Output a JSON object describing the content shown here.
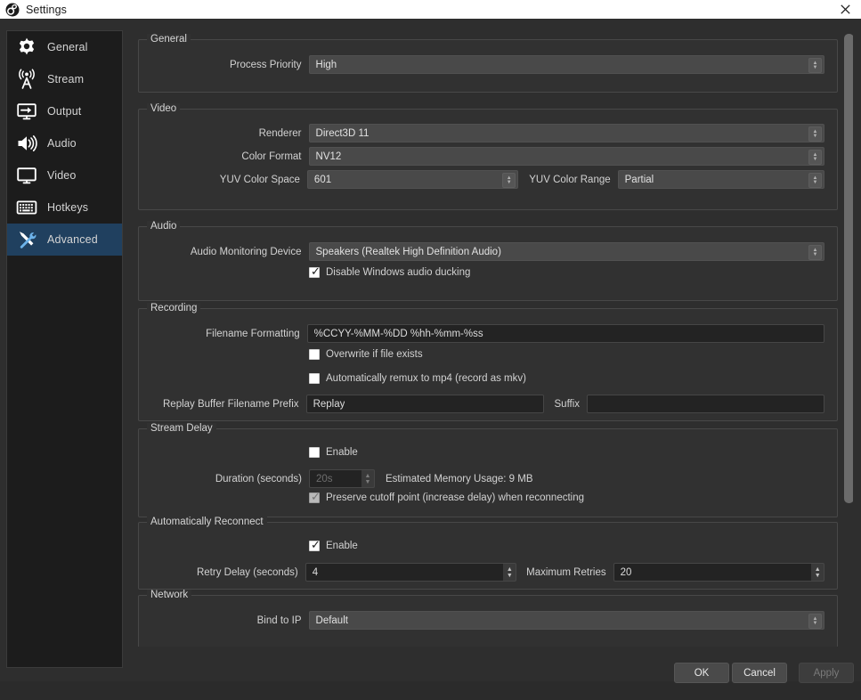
{
  "window": {
    "title": "Settings",
    "app_icon": "obs-logo-icon",
    "close_icon": "close-icon"
  },
  "sidebar": {
    "items": [
      {
        "label": "General",
        "icon": "gear-icon",
        "selected": false
      },
      {
        "label": "Stream",
        "icon": "broadcast-icon",
        "selected": false
      },
      {
        "label": "Output",
        "icon": "output-icon",
        "selected": false
      },
      {
        "label": "Audio",
        "icon": "speaker-icon",
        "selected": false
      },
      {
        "label": "Video",
        "icon": "monitor-icon",
        "selected": false
      },
      {
        "label": "Hotkeys",
        "icon": "keyboard-icon",
        "selected": false
      },
      {
        "label": "Advanced",
        "icon": "tools-icon",
        "selected": true
      }
    ],
    "selected_color": "#20405f"
  },
  "sections": {
    "general": {
      "title": "General",
      "process_priority_label": "Process Priority",
      "process_priority_value": "High"
    },
    "video": {
      "title": "Video",
      "renderer_label": "Renderer",
      "renderer_value": "Direct3D 11",
      "color_format_label": "Color Format",
      "color_format_value": "NV12",
      "yuv_color_space_label": "YUV Color Space",
      "yuv_color_space_value": "601",
      "yuv_color_range_label": "YUV Color Range",
      "yuv_color_range_value": "Partial"
    },
    "audio": {
      "title": "Audio",
      "monitoring_device_label": "Audio Monitoring Device",
      "monitoring_device_value": "Speakers (Realtek High Definition Audio)",
      "ducking_label": "Disable Windows audio ducking",
      "ducking_checked": true
    },
    "recording": {
      "title": "Recording",
      "filename_formatting_label": "Filename Formatting",
      "filename_formatting_value": "%CCYY-%MM-%DD %hh-%mm-%ss",
      "overwrite_label": "Overwrite if file exists",
      "overwrite_checked": false,
      "remux_label": "Automatically remux to mp4 (record as mkv)",
      "remux_checked": false,
      "replay_prefix_label": "Replay Buffer Filename Prefix",
      "replay_prefix_value": "Replay",
      "suffix_label": "Suffix",
      "suffix_value": ""
    },
    "stream_delay": {
      "title": "Stream Delay",
      "enable_label": "Enable",
      "enable_checked": false,
      "duration_label": "Duration (seconds)",
      "duration_value": "20s",
      "duration_disabled": true,
      "memory_usage_text": "Estimated Memory Usage: 9 MB",
      "preserve_label": "Preserve cutoff point (increase delay) when reconnecting",
      "preserve_checked": true,
      "preserve_disabled": true
    },
    "auto_reconnect": {
      "title": "Automatically Reconnect",
      "enable_label": "Enable",
      "enable_checked": true,
      "retry_delay_label": "Retry Delay (seconds)",
      "retry_delay_value": "4",
      "max_retries_label": "Maximum Retries",
      "max_retries_value": "20"
    },
    "network": {
      "title": "Network",
      "bind_to_ip_label": "Bind to IP",
      "bind_to_ip_value": "Default"
    }
  },
  "footer": {
    "ok_label": "OK",
    "cancel_label": "Cancel",
    "apply_label": "Apply",
    "apply_disabled": true
  }
}
